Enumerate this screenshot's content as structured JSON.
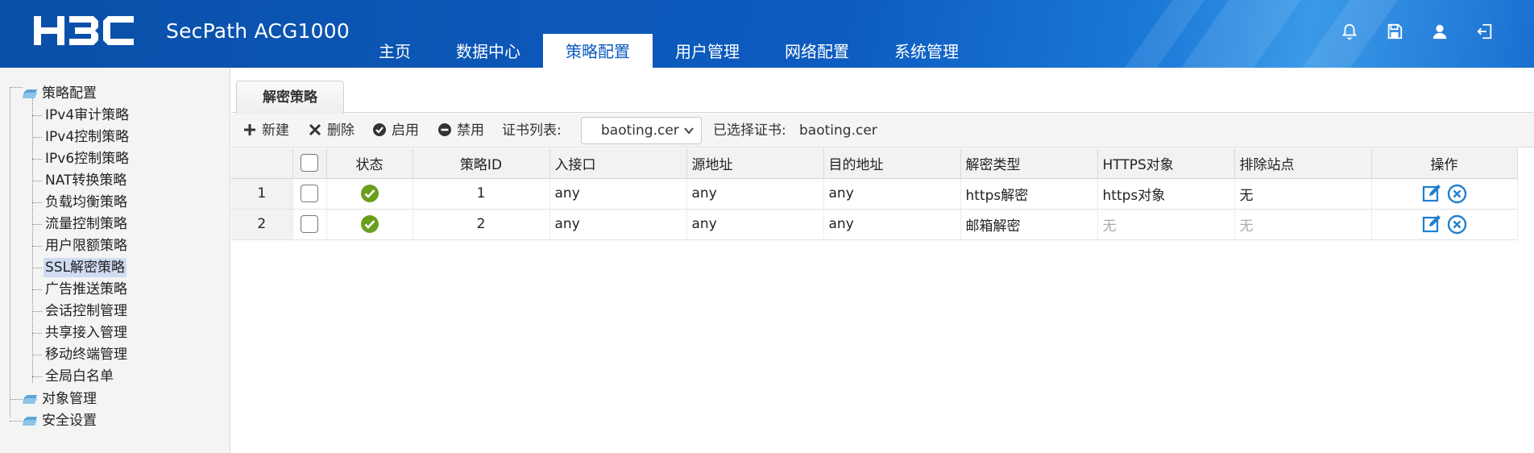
{
  "header": {
    "logo_text": "H3C",
    "product": "SecPath ACG1000",
    "nav": [
      {
        "label": "主页",
        "active": false
      },
      {
        "label": "数据中心",
        "active": false
      },
      {
        "label": "策略配置",
        "active": true
      },
      {
        "label": "用户管理",
        "active": false
      },
      {
        "label": "网络配置",
        "active": false
      },
      {
        "label": "系统管理",
        "active": false
      }
    ],
    "icons": [
      "bell-icon",
      "save-icon",
      "user-icon",
      "logout-icon"
    ]
  },
  "sidebar": {
    "groups": [
      {
        "label": "策略配置",
        "children": [
          {
            "label": "IPv4审计策略"
          },
          {
            "label": "IPv4控制策略"
          },
          {
            "label": "IPv6控制策略"
          },
          {
            "label": "NAT转换策略"
          },
          {
            "label": "负载均衡策略"
          },
          {
            "label": "流量控制策略"
          },
          {
            "label": "用户限额策略"
          },
          {
            "label": "SSL解密策略",
            "selected": true
          },
          {
            "label": "广告推送策略"
          },
          {
            "label": "会话控制管理"
          },
          {
            "label": "共享接入管理"
          },
          {
            "label": "移动终端管理"
          },
          {
            "label": "全局白名单"
          }
        ]
      },
      {
        "label": "对象管理"
      },
      {
        "label": "安全设置"
      }
    ]
  },
  "content": {
    "tab_label": "解密策略",
    "toolbar": {
      "new_label": "新建",
      "delete_label": "删除",
      "enable_label": "启用",
      "disable_label": "禁用",
      "cert_list_label": "证书列表:",
      "cert_select_value": "baoting.cer",
      "selected_cert_label": "已选择证书:",
      "selected_cert_value": "baoting.cer"
    },
    "table": {
      "headers": [
        "状态",
        "策略ID",
        "入接口",
        "源地址",
        "目的地址",
        "解密类型",
        "HTTPS对象",
        "排除站点",
        "操作"
      ],
      "rows": [
        {
          "no": "1",
          "status": "enabled",
          "id": "1",
          "in_if": "any",
          "src": "any",
          "dst": "any",
          "type": "https解密",
          "https_obj": "https对象",
          "exclude": "无"
        },
        {
          "no": "2",
          "status": "enabled",
          "id": "2",
          "in_if": "any",
          "src": "any",
          "dst": "any",
          "type": "邮箱解密",
          "https_obj": "无",
          "exclude": "无"
        }
      ]
    }
  },
  "colors": {
    "header_blue": "#0d5cc0",
    "status_green": "#6a9f1e",
    "action_blue": "#1f7fcf"
  }
}
